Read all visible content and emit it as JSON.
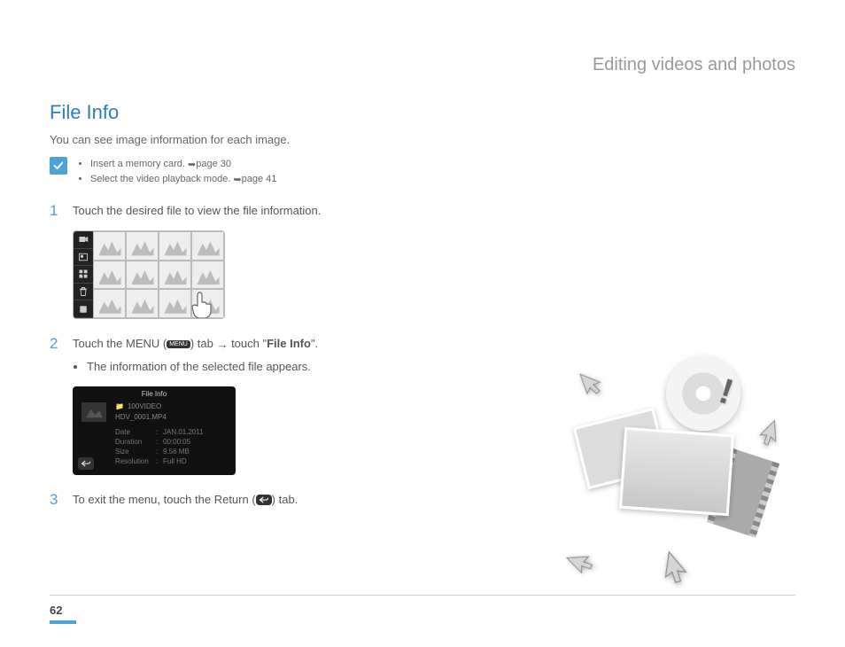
{
  "chapter_title": "Editing videos and photos",
  "section_title": "File Info",
  "intro": "You can see image information for each image.",
  "notes": [
    {
      "text_before": "Insert a memory card. ",
      "ref": "page 30"
    },
    {
      "text_before": "Select the video playback mode. ",
      "ref": "page 41"
    }
  ],
  "steps": {
    "s1": {
      "num": "1",
      "text": "Touch the desired file to view the file information."
    },
    "s2": {
      "num": "2",
      "part1": "Touch the MENU (",
      "badge": "MENU",
      "part2": ") tab ",
      "part3": " touch \"",
      "bold": "File Info",
      "part4": "\".",
      "sub": "The information of the selected file appears."
    },
    "s3": {
      "num": "3",
      "part1": "To exit the menu, touch the Return (",
      "part2": ") tab."
    }
  },
  "fileinfo_panel": {
    "title": "File Info",
    "folder": "100VIDEO",
    "filename": "HDV_0001.MP4",
    "rows": [
      {
        "k": "Date",
        "v": "JAN.01.2011"
      },
      {
        "k": "Duration",
        "v": "00:00:05"
      },
      {
        "k": "Size",
        "v": "9.56 MB"
      },
      {
        "k": "Resolution",
        "v": "Full HD"
      }
    ]
  },
  "page_number": "62"
}
